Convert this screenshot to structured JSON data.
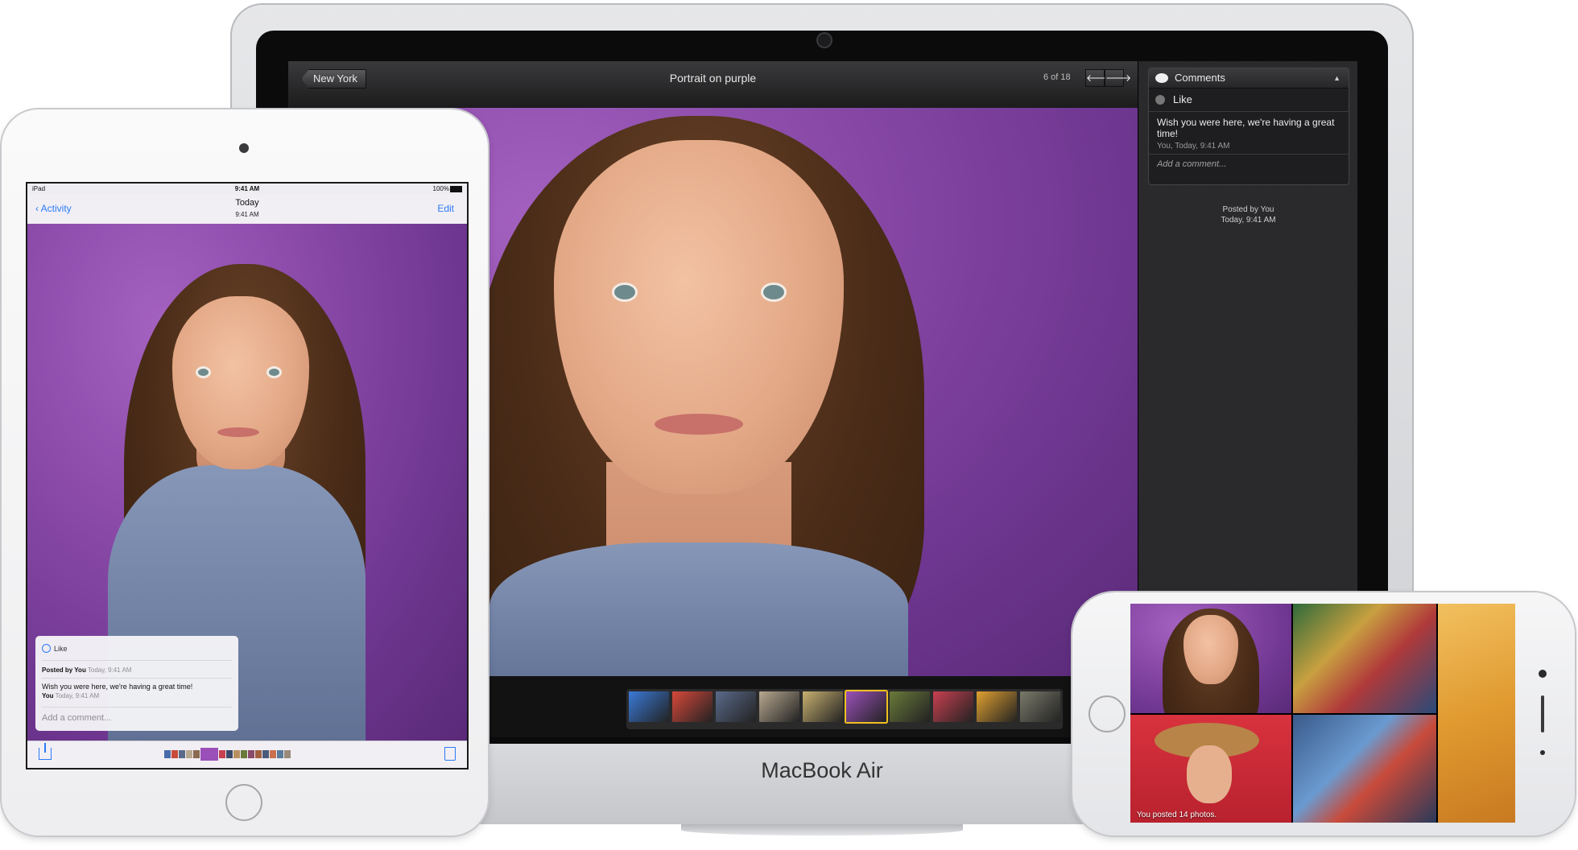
{
  "macbook": {
    "label": "MacBook Air",
    "back_label": "New York",
    "photo_title": "Portrait on purple",
    "counter": "6 of 18",
    "prev_arrow": "🡐",
    "next_arrow": "🡒",
    "comments": {
      "header": "Comments",
      "caret": "▲",
      "like": "Like",
      "comment_text": "Wish you were here, we're having a great time!",
      "comment_meta": "You, Today, 9:41 AM",
      "add_placeholder": "Add a comment..."
    },
    "posted_by": "Posted by You",
    "posted_time": "Today, 9:41 AM",
    "thumb_colors": [
      "#3a7ad8",
      "#d8483a",
      "#5a6a8a",
      "#b8a890",
      "#c8b070",
      "#9a50b8",
      "#6a7a3a",
      "#c84050",
      "#e0a030",
      "#7a7a6a"
    ],
    "selected_thumb_index": 5
  },
  "ipad": {
    "status": {
      "carrier": "iPad",
      "time": "9:41 AM",
      "battery": "100%"
    },
    "nav": {
      "back_label": "Activity",
      "title": "Today",
      "subtitle": "9:41 AM",
      "edit_label": "Edit"
    },
    "card": {
      "like": "Like",
      "posted_by": "Posted by You",
      "posted_time": "Today, 9:41 AM",
      "comment_text": "Wish you were here, we're having a great time!",
      "comment_author": "You",
      "comment_time": "Today, 9:41 AM",
      "add_placeholder": "Add a comment..."
    },
    "thumb_colors": [
      "#4a6aa8",
      "#c84a3a",
      "#5a6a8a",
      "#b8a890",
      "#8a6a50",
      "#9a50b8",
      "#c84050",
      "#3a4a6a",
      "#b89060",
      "#6a7a3a",
      "#8a4a6a",
      "#a06040",
      "#4a5a7a",
      "#c87050",
      "#5a7a9a",
      "#9a8a7a"
    ],
    "selected_thumb_index": 5
  },
  "iphone": {
    "caption": "You posted 14 photos."
  }
}
